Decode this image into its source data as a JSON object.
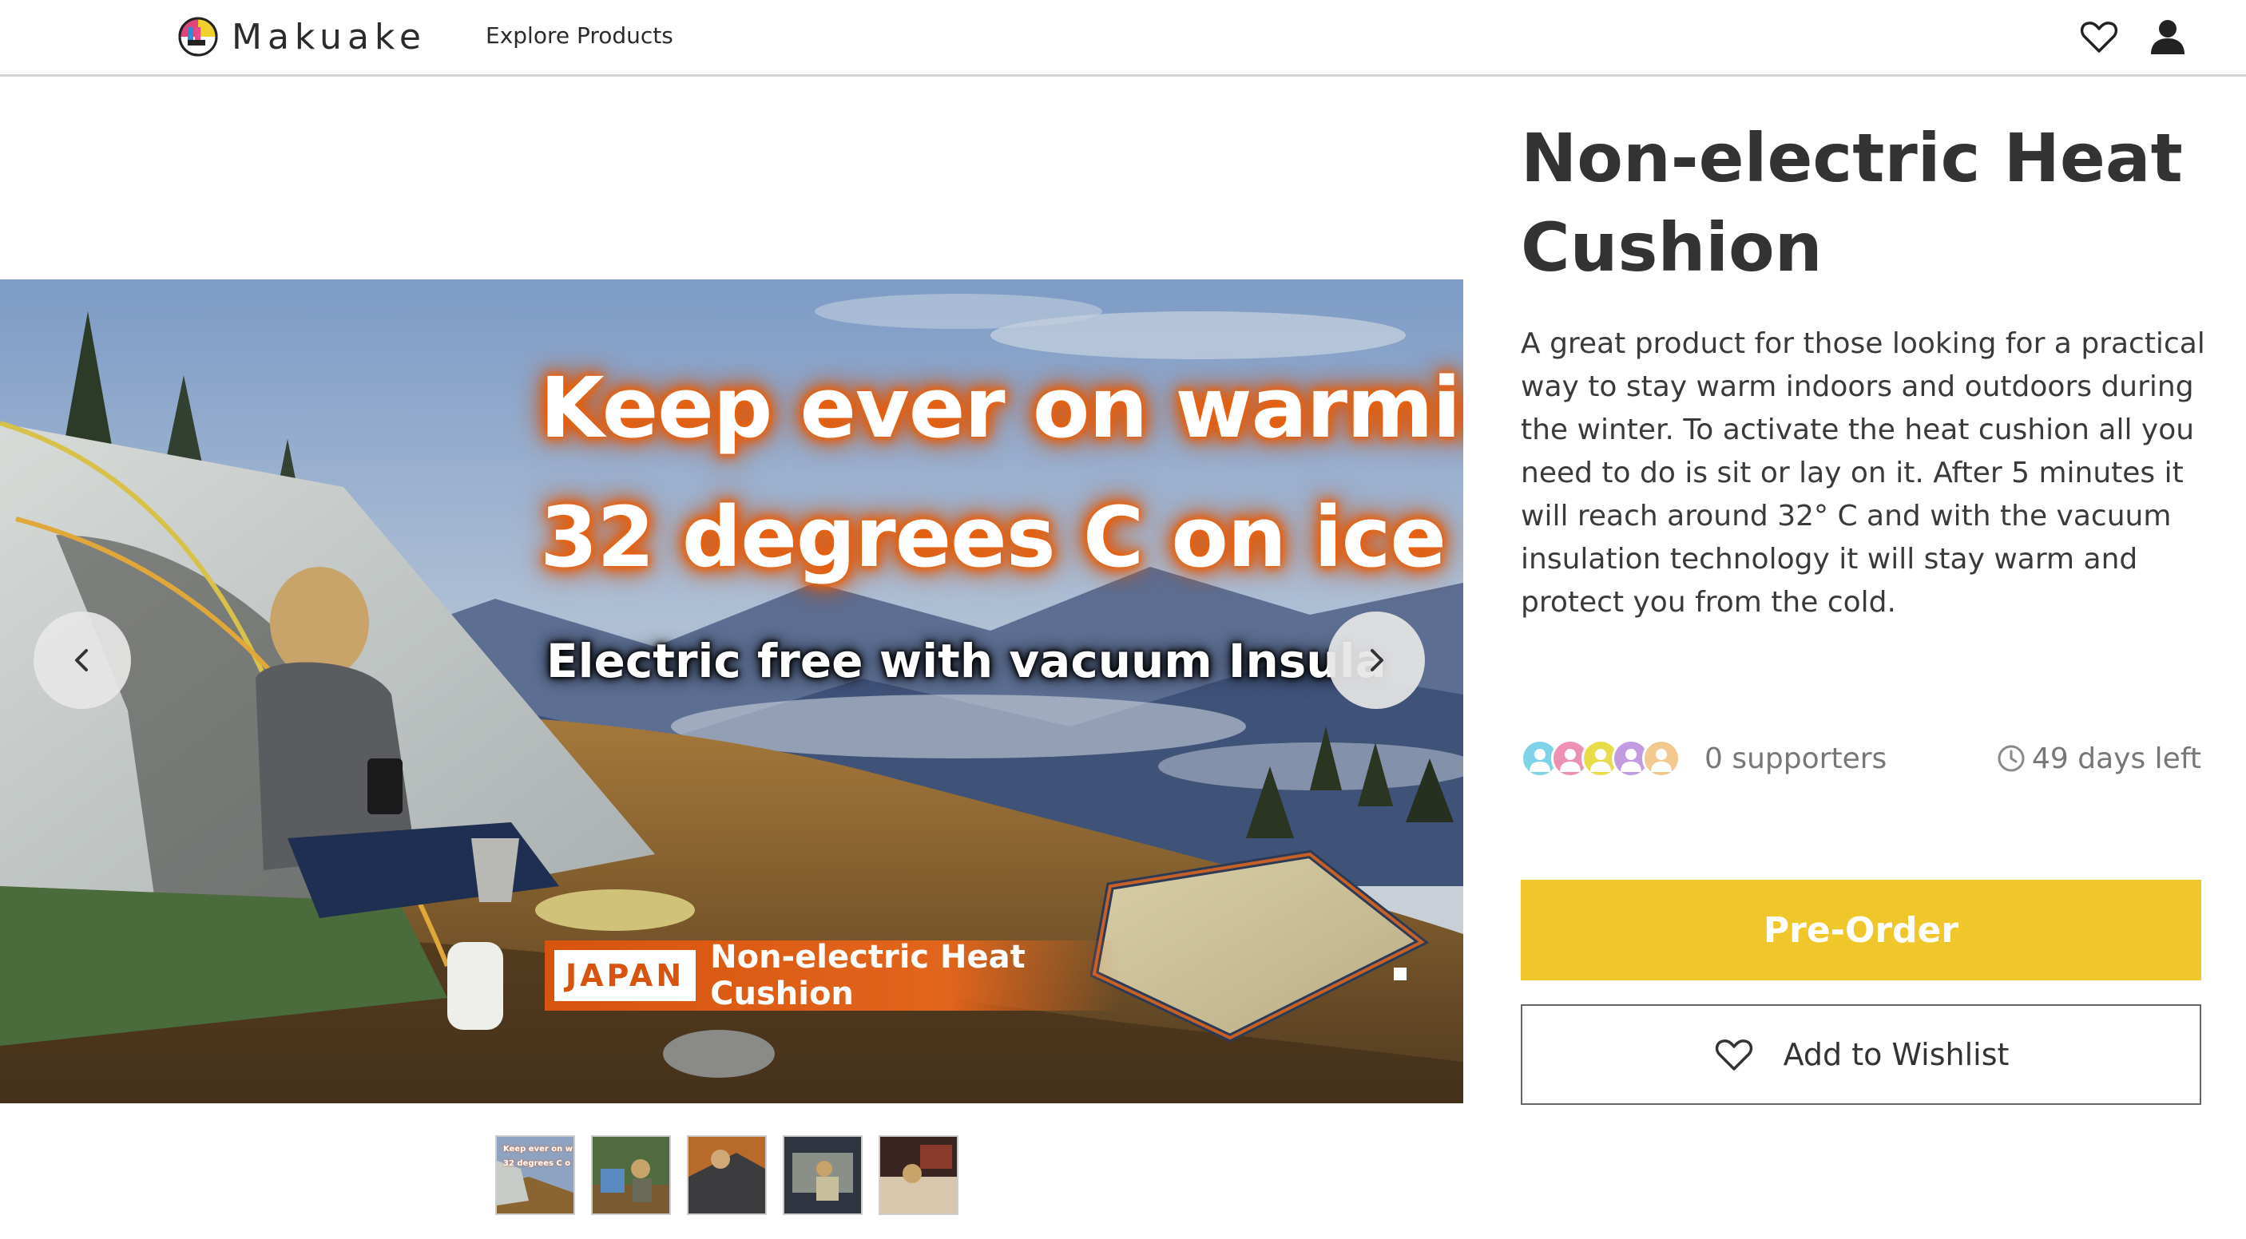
{
  "header": {
    "brand": "Makuake",
    "nav_explore": "Explore Products",
    "icons": [
      "heart-icon",
      "user-icon"
    ]
  },
  "hero": {
    "headline_1": "Keep ever on warming",
    "headline_2": "32 degrees C on ice",
    "subline": "Electric free with vacuum Insula",
    "banner_tag": "JAPAN",
    "banner_text": "Non-electric Heat Cushion",
    "prev_icon": "chevron-left-icon",
    "next_icon": "chevron-right-icon"
  },
  "thumbnails": {
    "count": 5,
    "first_caption_1": "Keep ever on w",
    "first_caption_2": "32 degrees C o"
  },
  "product": {
    "title": "Non-electric Heat Cushion",
    "description": "A great product for those looking for a practical way to stay warm indoors and outdoors during the winter. To activate the heat cushion all you need to do is sit or lay on it. After 5 minutes it will reach around 32° C and with the vacuum insulation technology it will stay warm and protect you from the cold.",
    "supporters_text": "0 supporters",
    "days_left_text": "49 days left",
    "preorder_label": "Pre-Order",
    "wishlist_label": "Add to Wishlist"
  },
  "colors": {
    "preorder_bg": "#efc72a",
    "headline_glow": "#e8610f",
    "avatar_colors": [
      "#7fd3e8",
      "#ee8fb4",
      "#e8dc4a",
      "#c39be0",
      "#f2c98e"
    ]
  }
}
